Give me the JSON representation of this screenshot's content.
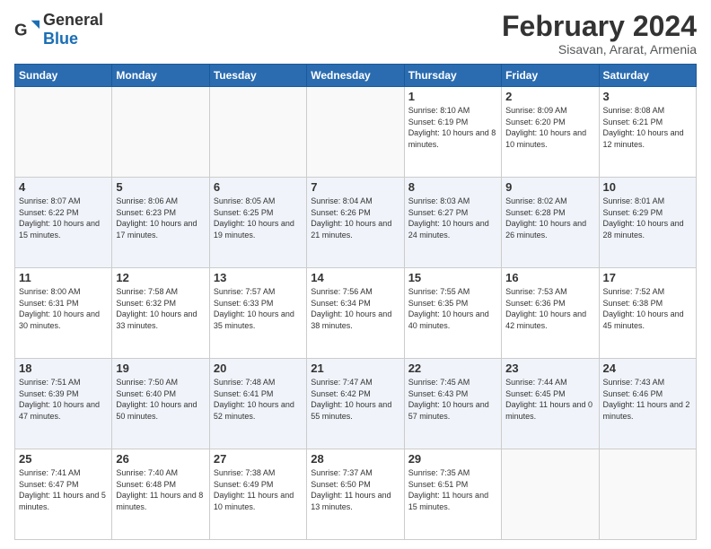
{
  "logo": {
    "general": "General",
    "blue": "Blue"
  },
  "header": {
    "title": "February 2024",
    "subtitle": "Sisavan, Ararat, Armenia"
  },
  "days_of_week": [
    "Sunday",
    "Monday",
    "Tuesday",
    "Wednesday",
    "Thursday",
    "Friday",
    "Saturday"
  ],
  "weeks": [
    [
      {
        "day": "",
        "info": ""
      },
      {
        "day": "",
        "info": ""
      },
      {
        "day": "",
        "info": ""
      },
      {
        "day": "",
        "info": ""
      },
      {
        "day": "1",
        "info": "Sunrise: 8:10 AM\nSunset: 6:19 PM\nDaylight: 10 hours\nand 8 minutes."
      },
      {
        "day": "2",
        "info": "Sunrise: 8:09 AM\nSunset: 6:20 PM\nDaylight: 10 hours\nand 10 minutes."
      },
      {
        "day": "3",
        "info": "Sunrise: 8:08 AM\nSunset: 6:21 PM\nDaylight: 10 hours\nand 12 minutes."
      }
    ],
    [
      {
        "day": "4",
        "info": "Sunrise: 8:07 AM\nSunset: 6:22 PM\nDaylight: 10 hours\nand 15 minutes."
      },
      {
        "day": "5",
        "info": "Sunrise: 8:06 AM\nSunset: 6:23 PM\nDaylight: 10 hours\nand 17 minutes."
      },
      {
        "day": "6",
        "info": "Sunrise: 8:05 AM\nSunset: 6:25 PM\nDaylight: 10 hours\nand 19 minutes."
      },
      {
        "day": "7",
        "info": "Sunrise: 8:04 AM\nSunset: 6:26 PM\nDaylight: 10 hours\nand 21 minutes."
      },
      {
        "day": "8",
        "info": "Sunrise: 8:03 AM\nSunset: 6:27 PM\nDaylight: 10 hours\nand 24 minutes."
      },
      {
        "day": "9",
        "info": "Sunrise: 8:02 AM\nSunset: 6:28 PM\nDaylight: 10 hours\nand 26 minutes."
      },
      {
        "day": "10",
        "info": "Sunrise: 8:01 AM\nSunset: 6:29 PM\nDaylight: 10 hours\nand 28 minutes."
      }
    ],
    [
      {
        "day": "11",
        "info": "Sunrise: 8:00 AM\nSunset: 6:31 PM\nDaylight: 10 hours\nand 30 minutes."
      },
      {
        "day": "12",
        "info": "Sunrise: 7:58 AM\nSunset: 6:32 PM\nDaylight: 10 hours\nand 33 minutes."
      },
      {
        "day": "13",
        "info": "Sunrise: 7:57 AM\nSunset: 6:33 PM\nDaylight: 10 hours\nand 35 minutes."
      },
      {
        "day": "14",
        "info": "Sunrise: 7:56 AM\nSunset: 6:34 PM\nDaylight: 10 hours\nand 38 minutes."
      },
      {
        "day": "15",
        "info": "Sunrise: 7:55 AM\nSunset: 6:35 PM\nDaylight: 10 hours\nand 40 minutes."
      },
      {
        "day": "16",
        "info": "Sunrise: 7:53 AM\nSunset: 6:36 PM\nDaylight: 10 hours\nand 42 minutes."
      },
      {
        "day": "17",
        "info": "Sunrise: 7:52 AM\nSunset: 6:38 PM\nDaylight: 10 hours\nand 45 minutes."
      }
    ],
    [
      {
        "day": "18",
        "info": "Sunrise: 7:51 AM\nSunset: 6:39 PM\nDaylight: 10 hours\nand 47 minutes."
      },
      {
        "day": "19",
        "info": "Sunrise: 7:50 AM\nSunset: 6:40 PM\nDaylight: 10 hours\nand 50 minutes."
      },
      {
        "day": "20",
        "info": "Sunrise: 7:48 AM\nSunset: 6:41 PM\nDaylight: 10 hours\nand 52 minutes."
      },
      {
        "day": "21",
        "info": "Sunrise: 7:47 AM\nSunset: 6:42 PM\nDaylight: 10 hours\nand 55 minutes."
      },
      {
        "day": "22",
        "info": "Sunrise: 7:45 AM\nSunset: 6:43 PM\nDaylight: 10 hours\nand 57 minutes."
      },
      {
        "day": "23",
        "info": "Sunrise: 7:44 AM\nSunset: 6:45 PM\nDaylight: 11 hours\nand 0 minutes."
      },
      {
        "day": "24",
        "info": "Sunrise: 7:43 AM\nSunset: 6:46 PM\nDaylight: 11 hours\nand 2 minutes."
      }
    ],
    [
      {
        "day": "25",
        "info": "Sunrise: 7:41 AM\nSunset: 6:47 PM\nDaylight: 11 hours\nand 5 minutes."
      },
      {
        "day": "26",
        "info": "Sunrise: 7:40 AM\nSunset: 6:48 PM\nDaylight: 11 hours\nand 8 minutes."
      },
      {
        "day": "27",
        "info": "Sunrise: 7:38 AM\nSunset: 6:49 PM\nDaylight: 11 hours\nand 10 minutes."
      },
      {
        "day": "28",
        "info": "Sunrise: 7:37 AM\nSunset: 6:50 PM\nDaylight: 11 hours\nand 13 minutes."
      },
      {
        "day": "29",
        "info": "Sunrise: 7:35 AM\nSunset: 6:51 PM\nDaylight: 11 hours\nand 15 minutes."
      },
      {
        "day": "",
        "info": ""
      },
      {
        "day": "",
        "info": ""
      }
    ]
  ]
}
